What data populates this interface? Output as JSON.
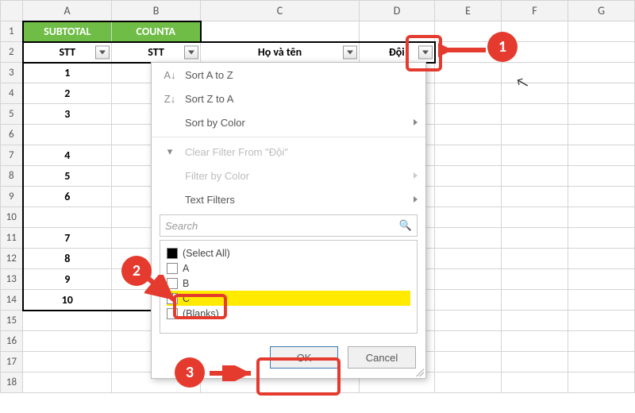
{
  "columns": [
    "A",
    "B",
    "C",
    "D",
    "E",
    "F",
    "G"
  ],
  "row1": {
    "A": "SUBTOTAL",
    "B": "COUNTA"
  },
  "row2": {
    "A": "STT",
    "B": "STT",
    "C": "Họ và tên",
    "D": "Đội"
  },
  "stt_values": {
    "3": "1",
    "4": "2",
    "5": "3",
    "7": "4",
    "8": "5",
    "9": "6",
    "11": "7",
    "12": "8",
    "13": "9",
    "14": "10"
  },
  "popup": {
    "sort_az": "Sort A to Z",
    "sort_za": "Sort Z to A",
    "sort_color": "Sort by Color",
    "clear": "Clear Filter From \"Đội\"",
    "filter_color": "Filter by Color",
    "text_filters": "Text Filters",
    "search_placeholder": "Search",
    "items": {
      "select_all": "(Select All)",
      "a": "A",
      "b": "B",
      "c": "C",
      "blanks": "(Blanks)"
    },
    "ok": "OK",
    "cancel": "Cancel"
  },
  "callouts": {
    "c1": "1",
    "c2": "2",
    "c3": "3"
  }
}
